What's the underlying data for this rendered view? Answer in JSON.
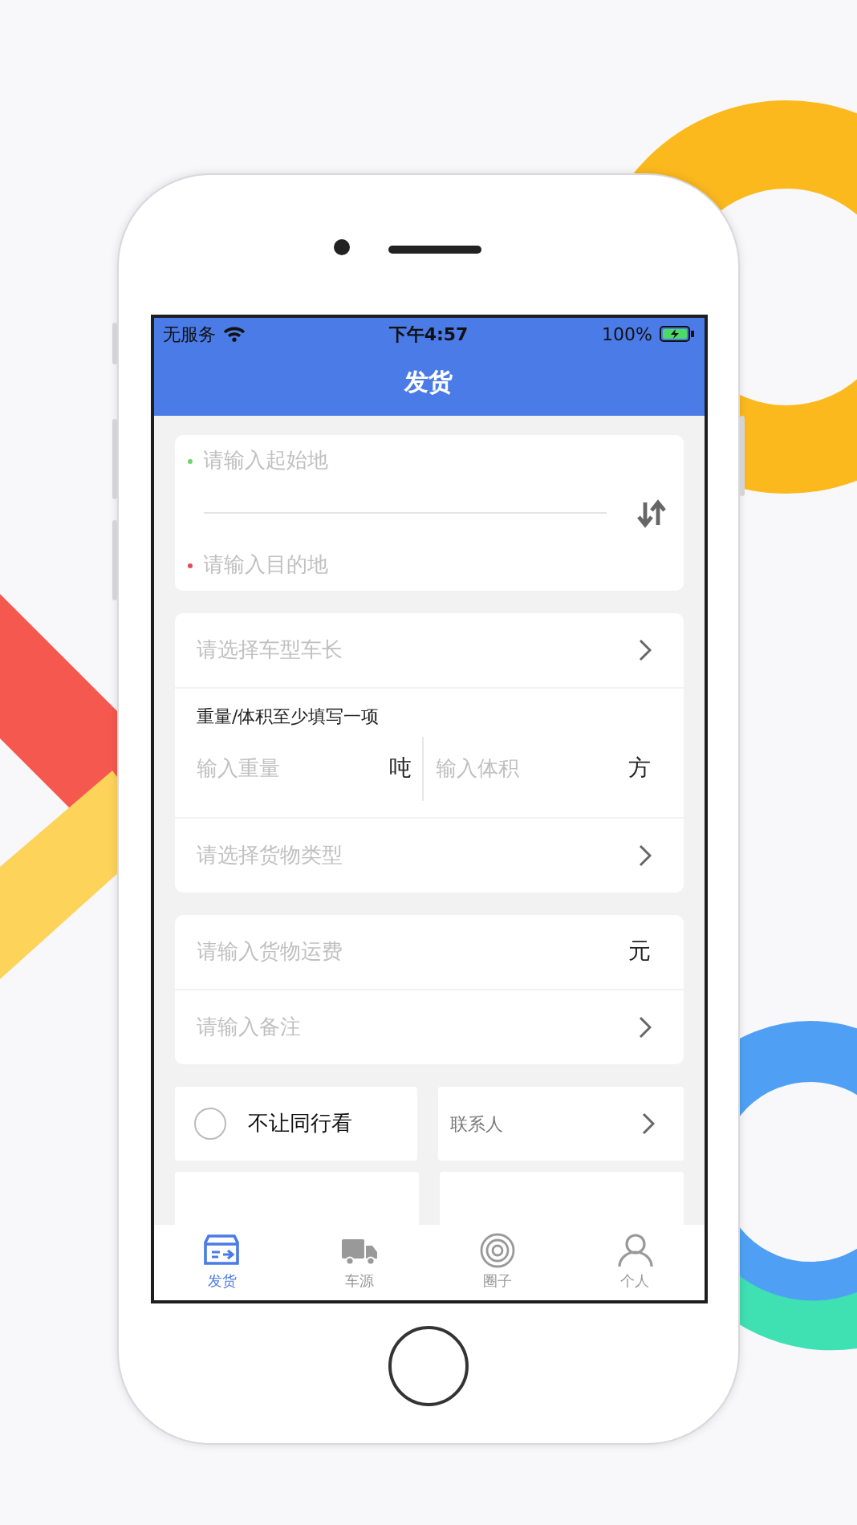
{
  "status_bar": {
    "carrier": "无服务",
    "time": "下午4:57",
    "battery": "100%"
  },
  "title": "发货",
  "route": {
    "origin": {
      "placeholder": "请输入起始地",
      "color": "#6cd46c"
    },
    "destination": {
      "placeholder": "请输入目的地",
      "color": "#e8485a"
    }
  },
  "vehicle": {
    "placeholder": "请选择车型车长"
  },
  "measure": {
    "hint": "重量/体积至少填写一项",
    "weight": {
      "placeholder": "输入重量",
      "unit": "吨"
    },
    "volume": {
      "placeholder": "输入体积",
      "unit": "方"
    }
  },
  "cargo_type": {
    "placeholder": "请选择货物类型"
  },
  "freight": {
    "placeholder": "请输入货物运费",
    "unit": "元"
  },
  "remark": {
    "placeholder": "请输入备注"
  },
  "hide_from_peers": {
    "label": "不让同行看",
    "checked": false
  },
  "contact": {
    "label": "联系人"
  },
  "tabs": [
    {
      "label": "发货",
      "kind": "box",
      "selected": true
    },
    {
      "label": "车源",
      "kind": "truck",
      "selected": false
    },
    {
      "label": "圈子",
      "kind": "rings",
      "selected": false
    },
    {
      "label": "个人",
      "kind": "person",
      "selected": false
    }
  ]
}
